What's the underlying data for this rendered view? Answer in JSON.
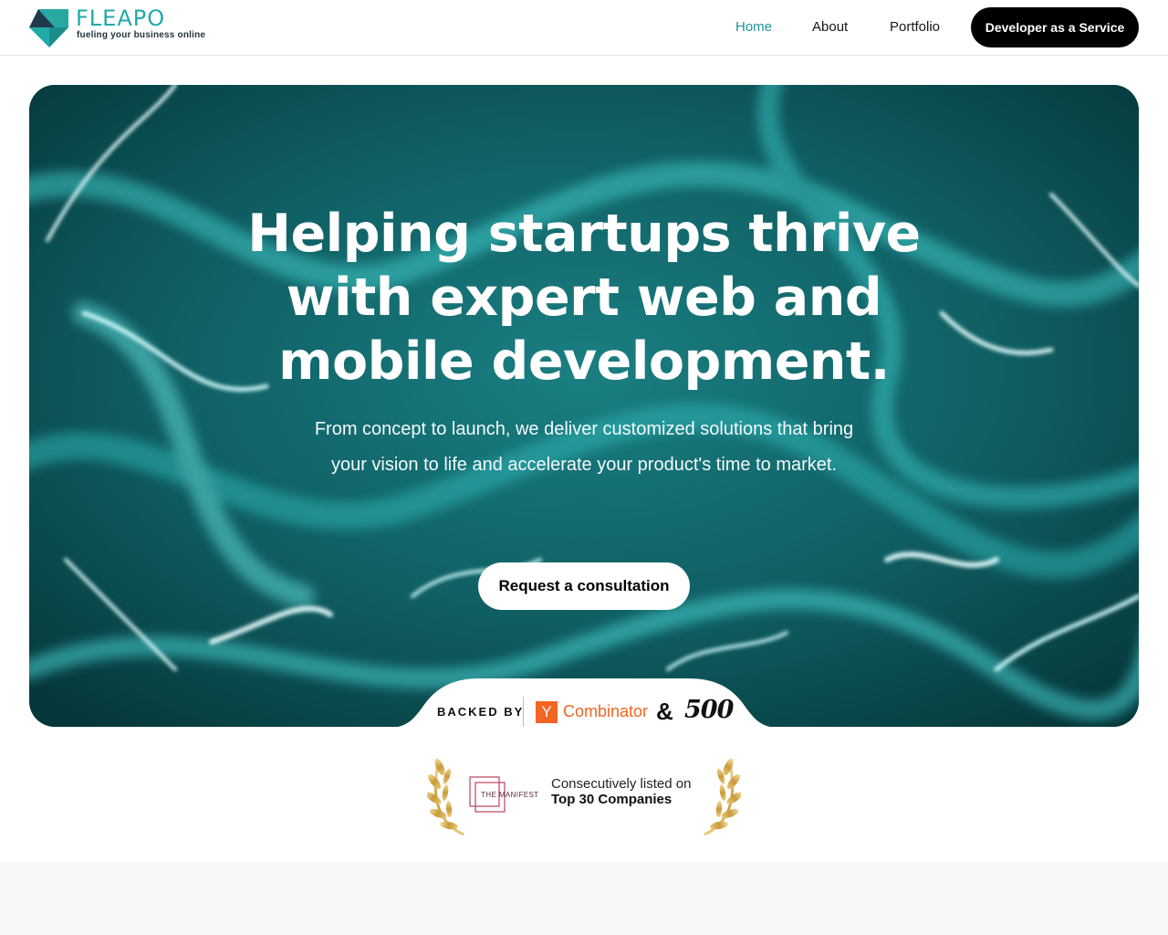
{
  "brand": {
    "name": "FLEAPO",
    "tagline": "fueling your business online",
    "primary_color": "#20aaa8"
  },
  "nav": {
    "items": [
      {
        "label": "Home",
        "active": true
      },
      {
        "label": "About",
        "active": false
      },
      {
        "label": "Portfolio",
        "active": false
      }
    ],
    "cta_label": "Developer as a Service"
  },
  "hero": {
    "title": "Helping startups thrive with expert web and mobile development.",
    "subtitle": "From concept to launch, we deliver customized solutions that bring your vision to life and accelerate your product's time to market.",
    "cta_label": "Request a consultation"
  },
  "backers": {
    "label": "BACKED BY",
    "yc_letter": "Y",
    "yc_word": "Combinator",
    "ampersand": "&",
    "second": "500",
    "yc_color": "#f26522"
  },
  "award": {
    "badge_text": "THE MANIFEST",
    "line1": "Consecutively listed on",
    "line2": "Top 30 Companies"
  }
}
